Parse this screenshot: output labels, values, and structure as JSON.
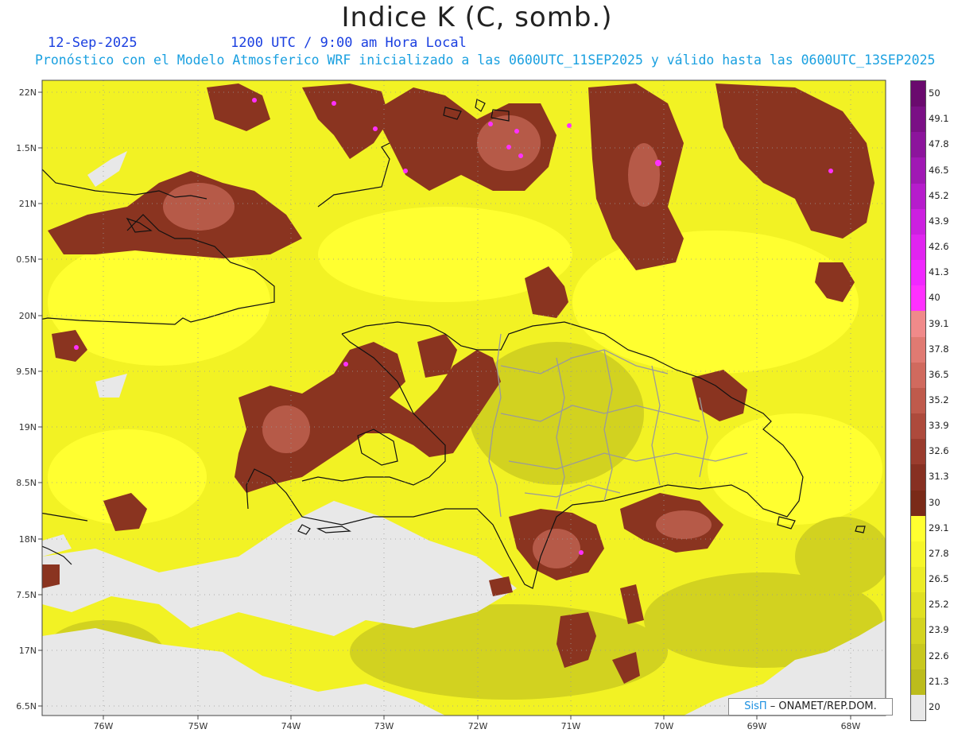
{
  "header": {
    "title": "Indice K (C, somb.)",
    "date": "12-Sep-2025",
    "time": "1200 UTC / 9:00 am Hora Local",
    "model": "Pronóstico con el Modelo Atmosferico WRF inicializado a las 0600UTC_11SEP2025 y válido hasta las  0600UTC_13SEP2025"
  },
  "axes": {
    "lon_labels": [
      "76W",
      "75W",
      "74W",
      "73W",
      "72W",
      "71W",
      "70W",
      "69W",
      "68W"
    ],
    "lat_labels": [
      "22N",
      "1.5N",
      "21N",
      "0.5N",
      "20N",
      "9.5N",
      "19N",
      "8.5N",
      "18N",
      "7.5N",
      "17N",
      "6.5N"
    ]
  },
  "colorbar": {
    "labels": [
      "50",
      "49.1",
      "47.8",
      "46.5",
      "45.2",
      "43.9",
      "42.6",
      "41.3",
      "40",
      "39.1",
      "37.8",
      "36.5",
      "35.2",
      "33.9",
      "32.6",
      "31.3",
      "30",
      "29.1",
      "27.8",
      "26.5",
      "25.2",
      "23.9",
      "22.6",
      "21.3",
      "20"
    ],
    "colors": [
      "#6a0a6e",
      "#7a1085",
      "#8c149c",
      "#a018b4",
      "#b61ccc",
      "#cc20e0",
      "#e024f0",
      "#f028ff",
      "#ff30ff",
      "#f08a8a",
      "#e07a72",
      "#d06a5e",
      "#bf5a4c",
      "#ad4a3c",
      "#9a3c2e",
      "#873022",
      "#7a2a18",
      "#ffff30",
      "#f6f62a",
      "#ecec26",
      "#e0e022",
      "#d4d420",
      "#c8c81e",
      "#bcbc1c",
      "#e8e8e8"
    ]
  },
  "credit": {
    "brand": "SisΠ",
    "text": " – ONAMET/REP.DOM."
  }
}
